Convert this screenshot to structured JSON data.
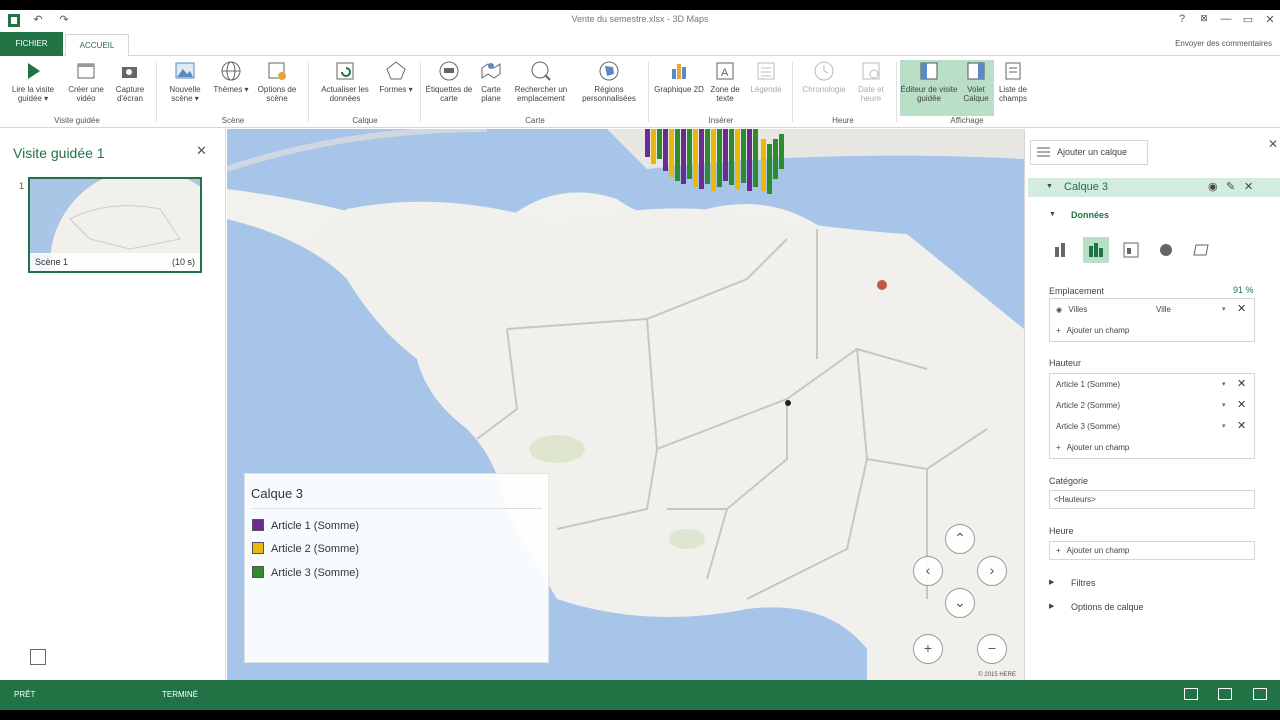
{
  "window": {
    "title": "Vente du semestre.xlsx - 3D Maps",
    "help": "?",
    "minimize": "—",
    "restore": "▭",
    "close": "✕"
  },
  "tabs": {
    "file": "FICHIER",
    "home": "ACCUEIL",
    "feedback": "Envoyer des commentaires"
  },
  "ribbon": {
    "play_tour": "Lire la visite guidée ▾",
    "create_video": "Créer une vidéo",
    "capture": "Capture d'écran",
    "group_tour": "Visite guidée",
    "new_scene": "Nouvelle scène ▾",
    "themes": "Thèmes ▾",
    "scene_options": "Options de scène",
    "group_scene": "Scène",
    "refresh": "Actualiser les données",
    "shapes": "Formes ▾",
    "group_layer": "Calque",
    "map_labels": "Étiquettes de carte",
    "flat_map": "Carte plane",
    "find_location": "Rechercher un emplacement",
    "custom_regions": "Régions personnalisées",
    "group_map": "Carte",
    "chart_2d": "Graphique 2D",
    "text_box": "Zone de texte",
    "legend": "Légende",
    "group_insert": "Insérer",
    "timeline": "Chronologie",
    "date_time": "Date et heure",
    "group_time": "Heure",
    "tour_editor": "Éditeur de visite guidée",
    "layer_pane": "Volet Calque",
    "field_list": "Liste de champs",
    "group_view": "Affichage"
  },
  "left_panel": {
    "title": "Visite guidée 1",
    "close": "✕",
    "scene_index": "1",
    "scene_name": "Scène 1",
    "scene_duration": "(10 s)"
  },
  "legend": {
    "title": "Calque 3",
    "items": [
      {
        "label": "Article 1 (Somme)",
        "color": "#6b2c91"
      },
      {
        "label": "Article 2 (Somme)",
        "color": "#e8b90c"
      },
      {
        "label": "Article 3 (Somme)",
        "color": "#2e8b2e"
      }
    ]
  },
  "map_nav": {
    "up": "⌃",
    "left": "‹",
    "right": "›",
    "down": "⌄",
    "zoom_in": "+",
    "zoom_out": "−",
    "copyright": "© 2015 HERE"
  },
  "right_panel": {
    "add_layer": "Ajouter un calque",
    "close": "✕",
    "layer_name": "Calque 3",
    "data_section": "Données",
    "location_label": "Emplacement",
    "location_confidence": "91 %",
    "location_field": "Villes",
    "location_type": "Ville",
    "add_field": "Ajouter un champ",
    "height_label": "Hauteur",
    "height_fields": [
      "Article 1 (Somme)",
      "Article 2 (Somme)",
      "Article 3 (Somme)"
    ],
    "category_label": "Catégorie",
    "category_value": "<Hauteurs>",
    "time_label": "Heure",
    "filters": "Filtres",
    "layer_options": "Options de calque"
  },
  "status": {
    "ready": "PRÊT",
    "done": "TERMINÉ"
  }
}
